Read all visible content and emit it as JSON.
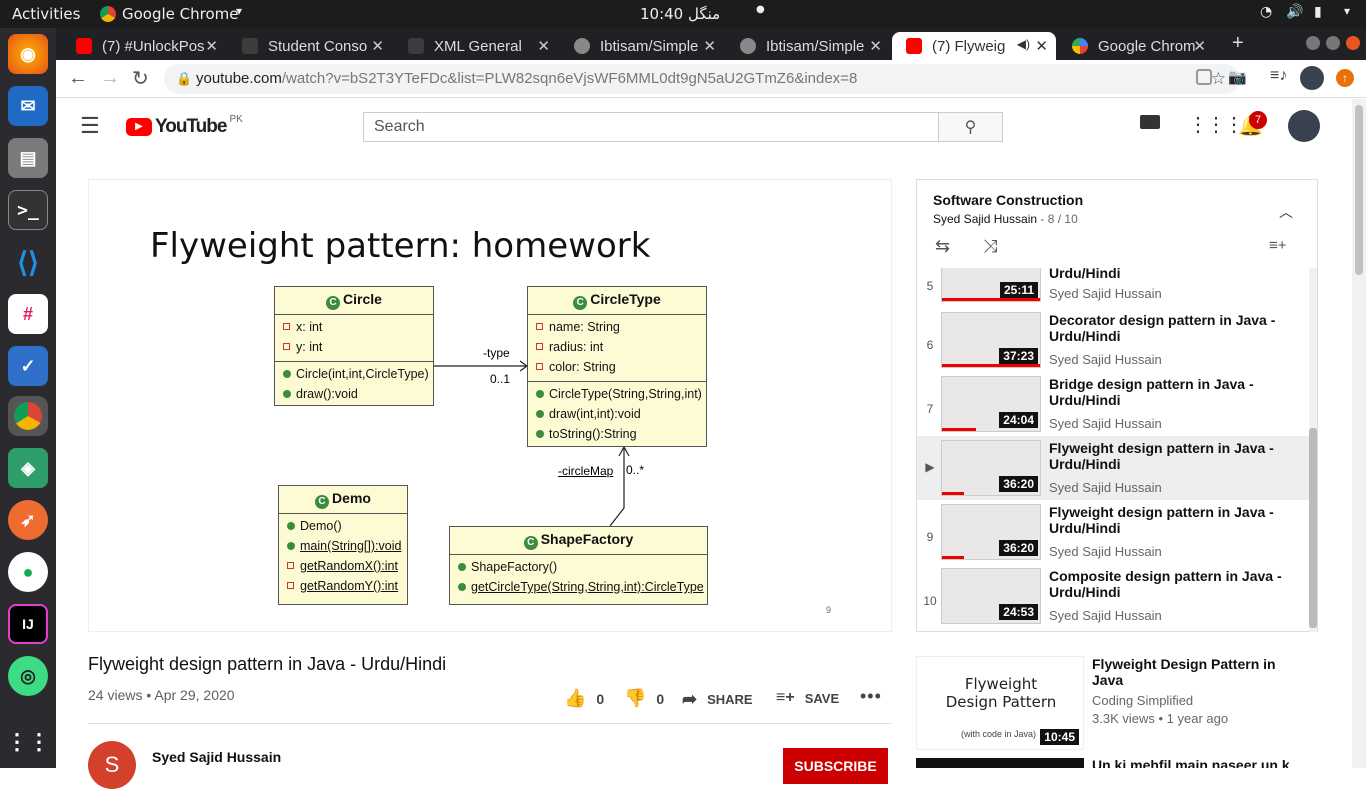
{
  "system": {
    "activities": "Activities",
    "app_menu": "Google Chrome",
    "clock": "10:40 منگل"
  },
  "tabs": [
    {
      "label": "(7) #UnlockPos",
      "favicon": "youtube"
    },
    {
      "label": "Student Conso",
      "favicon": "generic"
    },
    {
      "label": "XML General",
      "favicon": "generic"
    },
    {
      "label": "Ibtisam/Simple",
      "favicon": "github"
    },
    {
      "label": "Ibtisam/Simple",
      "favicon": "github"
    },
    {
      "label": "(7) Flyweig",
      "favicon": "youtube",
      "active": true
    },
    {
      "label": "Google Chrom",
      "favicon": "google"
    }
  ],
  "address": {
    "host": "youtube.com",
    "path": "/watch?v=bS2T3YTeFDc&list=PLW82sqn6eVjsWF6MML0dt9gN5aU2GTmZ6&index=8"
  },
  "yt": {
    "logo": "YouTube",
    "region": "PK",
    "search_placeholder": "Search",
    "notif_count": "7"
  },
  "slide": {
    "title": "Flyweight pattern: homework",
    "page": "9",
    "circle": {
      "name": "Circle",
      "fields": [
        "x: int",
        "y: int"
      ],
      "methods": [
        "Circle(int,int,CircleType)",
        "draw():void"
      ]
    },
    "circletype": {
      "name": "CircleType",
      "fields": [
        "name: String",
        "radius: int",
        "color: String"
      ],
      "methods": [
        "CircleType(String,String,int)",
        "draw(int,int):void",
        "toString():String"
      ]
    },
    "demo": {
      "name": "Demo",
      "methods": [
        "Demo()",
        "main(String[]):void",
        "getRandomX():int",
        "getRandomY():int"
      ]
    },
    "factory": {
      "name": "ShapeFactory",
      "methods": [
        "ShapeFactory()",
        "getCircleType(String,String,int):CircleType"
      ]
    },
    "assoc1_role": "-type",
    "assoc1_mult": "0..1",
    "assoc2_role": "-circleMap",
    "assoc2_mult": "0..*"
  },
  "video": {
    "title": "Flyweight design pattern in Java - Urdu/Hindi",
    "meta": "24 views • Apr 29, 2020",
    "likes": "0",
    "dislikes": "0",
    "share": "SHARE",
    "save": "SAVE",
    "channel": "Syed Sajid Hussain",
    "subscribe": "SUBSCRIBE"
  },
  "playlist": {
    "title": "Software Construction",
    "owner": "Syed Sajid Hussain",
    "position": "- 8 / 10",
    "items": [
      {
        "num": "5",
        "title": "Urdu/Hindi",
        "channel": "Syed Sajid Hussain",
        "duration": "25:11",
        "progress": 1.0
      },
      {
        "num": "6",
        "title": "Decorator design pattern in Java - Urdu/Hindi",
        "channel": "Syed Sajid Hussain",
        "duration": "37:23",
        "progress": 1.0
      },
      {
        "num": "7",
        "title": "Bridge design pattern in Java - Urdu/Hindi",
        "channel": "Syed Sajid Hussain",
        "duration": "24:04",
        "progress": 0.35
      },
      {
        "num": "▶",
        "title": "Flyweight design pattern in Java - Urdu/Hindi",
        "channel": "Syed Sajid Hussain",
        "duration": "36:20",
        "progress": 0.22
      },
      {
        "num": "9",
        "title": "Flyweight design pattern in Java - Urdu/Hindi",
        "channel": "Syed Sajid Hussain",
        "duration": "36:20",
        "progress": 0.22
      },
      {
        "num": "10",
        "title": "Composite design pattern in Java - Urdu/Hindi",
        "channel": "Syed Sajid Hussain",
        "duration": "24:53",
        "progress": 0
      }
    ]
  },
  "recommended": [
    {
      "title": "Flyweight Design Pattern in Java",
      "channel": "Coding Simplified",
      "meta": "3.3K views • 1 year ago",
      "duration": "10:45",
      "thumb_line1": "Flyweight",
      "thumb_line2": "Design Pattern",
      "thumb_line3": "(with code in Java)"
    },
    {
      "title": "Un ki mehfil main naseer un k"
    }
  ],
  "colors": {
    "yt_red": "#ff0000",
    "subscribe": "#cc0000",
    "uml_fill": "#fdfbd4"
  }
}
